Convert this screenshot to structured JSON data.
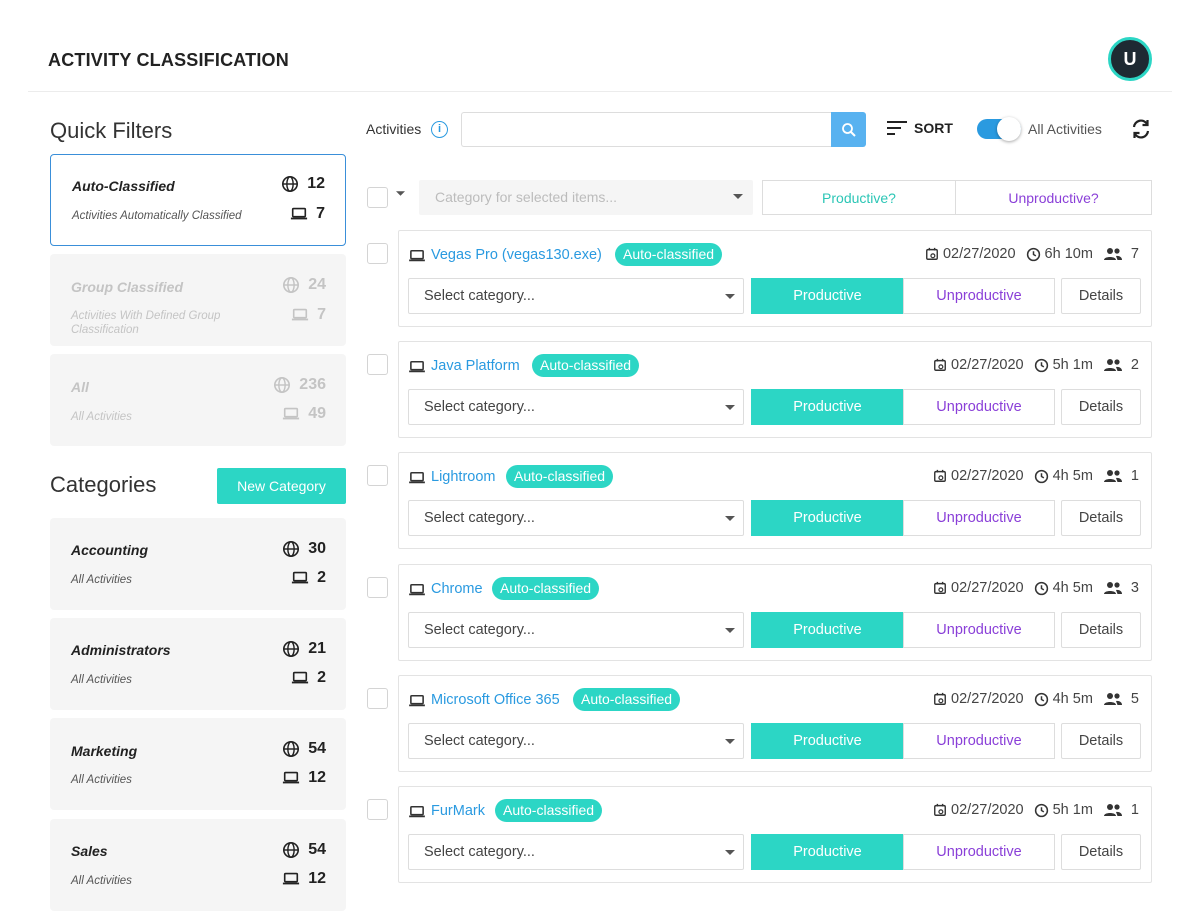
{
  "header": {
    "title": "ACTIVITY CLASSIFICATION",
    "avatar_initial": "U"
  },
  "quick_filters": {
    "title": "Quick Filters",
    "items": [
      {
        "name": "Auto-Classified",
        "sub": "Activities Automatically Classified",
        "web": "12",
        "apps": "7"
      },
      {
        "name": "Group Classified",
        "sub": "Activities With Defined Group Classification",
        "web": "24",
        "apps": "7"
      },
      {
        "name": "All",
        "sub": "All Activities",
        "web": "236",
        "apps": "49"
      }
    ]
  },
  "categories": {
    "title": "Categories",
    "new_button": "New Category",
    "items": [
      {
        "name": "Accounting",
        "sub": "All Activities",
        "web": "30",
        "apps": "2"
      },
      {
        "name": "Administrators",
        "sub": "All Activities",
        "web": "21",
        "apps": "2"
      },
      {
        "name": "Marketing",
        "sub": "All Activities",
        "web": "54",
        "apps": "12"
      },
      {
        "name": "Sales",
        "sub": "All Activities",
        "web": "54",
        "apps": "12"
      }
    ]
  },
  "toolbar": {
    "label": "Activities",
    "info": "i",
    "search_placeholder": "",
    "sort": "SORT",
    "toggle_label": "All Activities"
  },
  "bulk": {
    "category_placeholder": "Category for selected items...",
    "productive": "Productive?",
    "unproductive": "Unproductive?"
  },
  "activities": [
    {
      "name": "Vegas Pro (vegas130.exe)",
      "badge": "Auto-classified",
      "date": "02/27/2020",
      "duration": "6h 10m",
      "users": "7",
      "select": "Select category...",
      "productive": "Productive",
      "unproductive": "Unproductive",
      "details": "Details"
    },
    {
      "name": "Java Platform",
      "badge": "Auto-classified",
      "date": "02/27/2020",
      "duration": "5h 1m",
      "users": "2",
      "select": "Select category...",
      "productive": "Productive",
      "unproductive": "Unproductive",
      "details": "Details"
    },
    {
      "name": "Lightroom",
      "badge": "Auto-classified",
      "date": "02/27/2020",
      "duration": "4h 5m",
      "users": "1",
      "select": "Select category...",
      "productive": "Productive",
      "unproductive": "Unproductive",
      "details": "Details"
    },
    {
      "name": "Chrome",
      "badge": "Auto-classified",
      "date": "02/27/2020",
      "duration": "4h 5m",
      "users": "3",
      "select": "Select category...",
      "productive": "Productive",
      "unproductive": "Unproductive",
      "details": "Details"
    },
    {
      "name": "Microsoft Office 365",
      "badge": "Auto-classified",
      "date": "02/27/2020",
      "duration": "4h 5m",
      "users": "5",
      "select": "Select category...",
      "productive": "Productive",
      "unproductive": "Unproductive",
      "details": "Details"
    },
    {
      "name": "FurMark",
      "badge": "Auto-classified",
      "date": "02/27/2020",
      "duration": "5h 1m",
      "users": "1",
      "select": "Select category...",
      "productive": "Productive",
      "unproductive": "Unproductive",
      "details": "Details"
    }
  ],
  "colors": {
    "accent": "#2cd6c5",
    "link": "#2a9ae0",
    "unproductive": "#8a3fd8",
    "search_button": "#58b2f0"
  }
}
